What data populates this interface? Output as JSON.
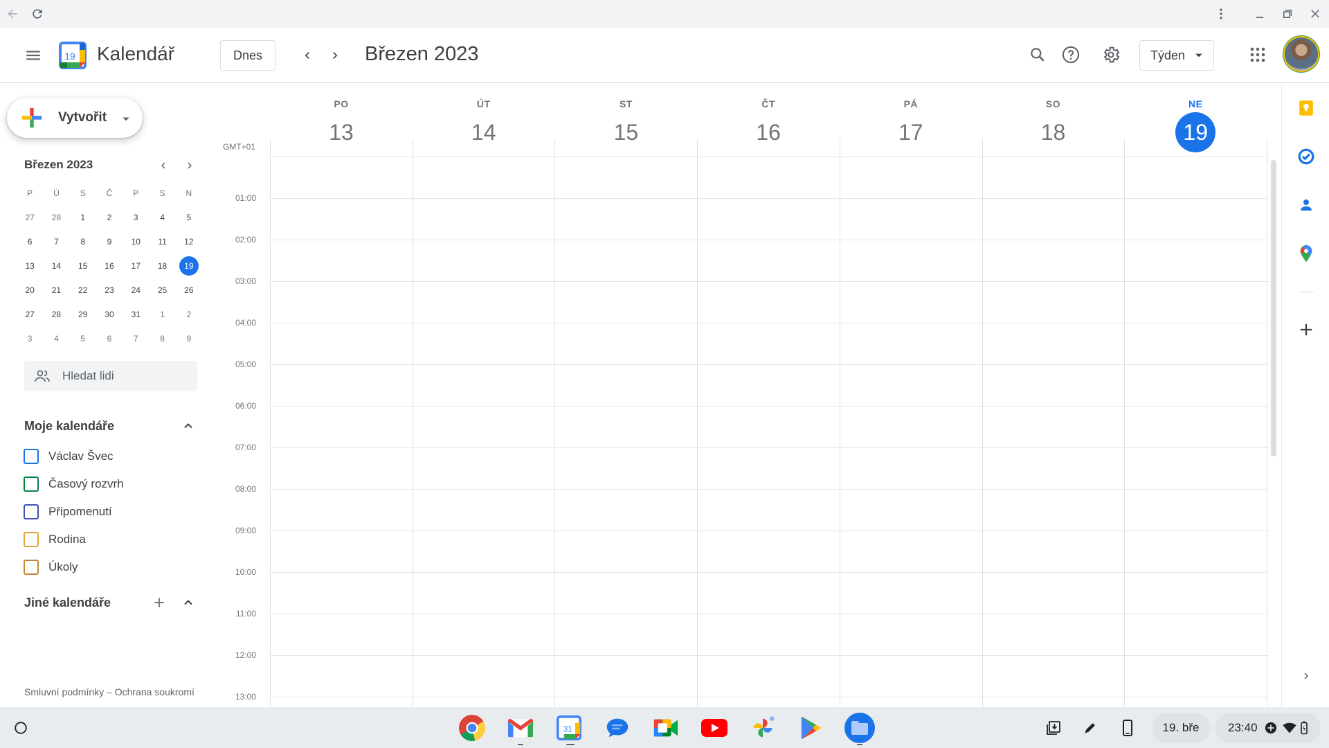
{
  "app": {
    "name": "Kalendář",
    "logo_day": "19"
  },
  "header": {
    "today_label": "Dnes",
    "period_title": "Březen 2023",
    "view_label": "Týden"
  },
  "sidebar": {
    "create_label": "Vytvořit",
    "mini_calendar": {
      "title": "Březen 2023",
      "weekday_headers": [
        "P",
        "Ú",
        "S",
        "Č",
        "P",
        "S",
        "N"
      ],
      "weeks": [
        [
          "27",
          "28",
          "1",
          "2",
          "3",
          "4",
          "5"
        ],
        [
          "6",
          "7",
          "8",
          "9",
          "10",
          "11",
          "12"
        ],
        [
          "13",
          "14",
          "15",
          "16",
          "17",
          "18",
          "19"
        ],
        [
          "20",
          "21",
          "22",
          "23",
          "24",
          "25",
          "26"
        ],
        [
          "27",
          "28",
          "29",
          "30",
          "31",
          "1",
          "2"
        ],
        [
          "3",
          "4",
          "5",
          "6",
          "7",
          "8",
          "9"
        ]
      ],
      "selected": "19"
    },
    "search_people_placeholder": "Hledat lidi",
    "my_calendars_title": "Moje kalendáře",
    "my_calendars": [
      {
        "name": "Václav Švec",
        "color": "#1a73e8"
      },
      {
        "name": "Časový rozvrh",
        "color": "#0b8043"
      },
      {
        "name": "Připomenutí",
        "color": "#3f51b5"
      },
      {
        "name": "Rodina",
        "color": "#e4a43c"
      },
      {
        "name": "Úkoly",
        "color": "#c5872e"
      }
    ],
    "other_calendars_title": "Jiné kalendáře",
    "footer": "Smluvní podmínky – Ochrana soukromí"
  },
  "week": {
    "timezone": "GMT+01",
    "days": [
      {
        "name": "PO",
        "date": "13"
      },
      {
        "name": "ÚT",
        "date": "14"
      },
      {
        "name": "ST",
        "date": "15"
      },
      {
        "name": "ČT",
        "date": "16"
      },
      {
        "name": "PÁ",
        "date": "17"
      },
      {
        "name": "SO",
        "date": "18"
      },
      {
        "name": "NE",
        "date": "19",
        "today": true
      }
    ],
    "hours": [
      "01:00",
      "02:00",
      "03:00",
      "04:00",
      "05:00",
      "06:00",
      "07:00",
      "08:00",
      "09:00",
      "10:00",
      "11:00",
      "12:00",
      "13:00"
    ]
  },
  "shelf": {
    "date": "19. bře",
    "time": "23:40",
    "apps": [
      "chrome-icon",
      "gmail-icon",
      "calendar-icon",
      "messages-icon",
      "meet-icon",
      "youtube-icon",
      "photos-icon",
      "play-store-icon",
      "files-icon"
    ],
    "calendar_app_day": "31"
  },
  "colors": {
    "accent": "#1a73e8",
    "today_bg": "#1a73e8"
  }
}
